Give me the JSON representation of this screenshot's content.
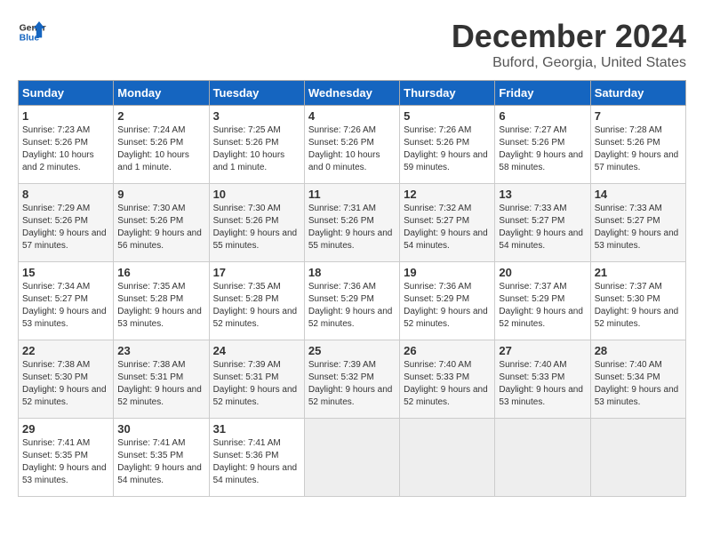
{
  "header": {
    "logo_general": "General",
    "logo_blue": "Blue",
    "month_title": "December 2024",
    "location": "Buford, Georgia, United States"
  },
  "calendar": {
    "days_of_week": [
      "Sunday",
      "Monday",
      "Tuesday",
      "Wednesday",
      "Thursday",
      "Friday",
      "Saturday"
    ],
    "weeks": [
      [
        null,
        null,
        null,
        null,
        null,
        null,
        null
      ]
    ]
  },
  "days": {
    "d1": {
      "num": "1",
      "sunrise": "Sunrise: 7:23 AM",
      "sunset": "Sunset: 5:26 PM",
      "daylight": "Daylight: 10 hours and 2 minutes."
    },
    "d2": {
      "num": "2",
      "sunrise": "Sunrise: 7:24 AM",
      "sunset": "Sunset: 5:26 PM",
      "daylight": "Daylight: 10 hours and 1 minute."
    },
    "d3": {
      "num": "3",
      "sunrise": "Sunrise: 7:25 AM",
      "sunset": "Sunset: 5:26 PM",
      "daylight": "Daylight: 10 hours and 1 minute."
    },
    "d4": {
      "num": "4",
      "sunrise": "Sunrise: 7:26 AM",
      "sunset": "Sunset: 5:26 PM",
      "daylight": "Daylight: 10 hours and 0 minutes."
    },
    "d5": {
      "num": "5",
      "sunrise": "Sunrise: 7:26 AM",
      "sunset": "Sunset: 5:26 PM",
      "daylight": "Daylight: 9 hours and 59 minutes."
    },
    "d6": {
      "num": "6",
      "sunrise": "Sunrise: 7:27 AM",
      "sunset": "Sunset: 5:26 PM",
      "daylight": "Daylight: 9 hours and 58 minutes."
    },
    "d7": {
      "num": "7",
      "sunrise": "Sunrise: 7:28 AM",
      "sunset": "Sunset: 5:26 PM",
      "daylight": "Daylight: 9 hours and 57 minutes."
    },
    "d8": {
      "num": "8",
      "sunrise": "Sunrise: 7:29 AM",
      "sunset": "Sunset: 5:26 PM",
      "daylight": "Daylight: 9 hours and 57 minutes."
    },
    "d9": {
      "num": "9",
      "sunrise": "Sunrise: 7:30 AM",
      "sunset": "Sunset: 5:26 PM",
      "daylight": "Daylight: 9 hours and 56 minutes."
    },
    "d10": {
      "num": "10",
      "sunrise": "Sunrise: 7:30 AM",
      "sunset": "Sunset: 5:26 PM",
      "daylight": "Daylight: 9 hours and 55 minutes."
    },
    "d11": {
      "num": "11",
      "sunrise": "Sunrise: 7:31 AM",
      "sunset": "Sunset: 5:26 PM",
      "daylight": "Daylight: 9 hours and 55 minutes."
    },
    "d12": {
      "num": "12",
      "sunrise": "Sunrise: 7:32 AM",
      "sunset": "Sunset: 5:27 PM",
      "daylight": "Daylight: 9 hours and 54 minutes."
    },
    "d13": {
      "num": "13",
      "sunrise": "Sunrise: 7:33 AM",
      "sunset": "Sunset: 5:27 PM",
      "daylight": "Daylight: 9 hours and 54 minutes."
    },
    "d14": {
      "num": "14",
      "sunrise": "Sunrise: 7:33 AM",
      "sunset": "Sunset: 5:27 PM",
      "daylight": "Daylight: 9 hours and 53 minutes."
    },
    "d15": {
      "num": "15",
      "sunrise": "Sunrise: 7:34 AM",
      "sunset": "Sunset: 5:27 PM",
      "daylight": "Daylight: 9 hours and 53 minutes."
    },
    "d16": {
      "num": "16",
      "sunrise": "Sunrise: 7:35 AM",
      "sunset": "Sunset: 5:28 PM",
      "daylight": "Daylight: 9 hours and 53 minutes."
    },
    "d17": {
      "num": "17",
      "sunrise": "Sunrise: 7:35 AM",
      "sunset": "Sunset: 5:28 PM",
      "daylight": "Daylight: 9 hours and 52 minutes."
    },
    "d18": {
      "num": "18",
      "sunrise": "Sunrise: 7:36 AM",
      "sunset": "Sunset: 5:29 PM",
      "daylight": "Daylight: 9 hours and 52 minutes."
    },
    "d19": {
      "num": "19",
      "sunrise": "Sunrise: 7:36 AM",
      "sunset": "Sunset: 5:29 PM",
      "daylight": "Daylight: 9 hours and 52 minutes."
    },
    "d20": {
      "num": "20",
      "sunrise": "Sunrise: 7:37 AM",
      "sunset": "Sunset: 5:29 PM",
      "daylight": "Daylight: 9 hours and 52 minutes."
    },
    "d21": {
      "num": "21",
      "sunrise": "Sunrise: 7:37 AM",
      "sunset": "Sunset: 5:30 PM",
      "daylight": "Daylight: 9 hours and 52 minutes."
    },
    "d22": {
      "num": "22",
      "sunrise": "Sunrise: 7:38 AM",
      "sunset": "Sunset: 5:30 PM",
      "daylight": "Daylight: 9 hours and 52 minutes."
    },
    "d23": {
      "num": "23",
      "sunrise": "Sunrise: 7:38 AM",
      "sunset": "Sunset: 5:31 PM",
      "daylight": "Daylight: 9 hours and 52 minutes."
    },
    "d24": {
      "num": "24",
      "sunrise": "Sunrise: 7:39 AM",
      "sunset": "Sunset: 5:31 PM",
      "daylight": "Daylight: 9 hours and 52 minutes."
    },
    "d25": {
      "num": "25",
      "sunrise": "Sunrise: 7:39 AM",
      "sunset": "Sunset: 5:32 PM",
      "daylight": "Daylight: 9 hours and 52 minutes."
    },
    "d26": {
      "num": "26",
      "sunrise": "Sunrise: 7:40 AM",
      "sunset": "Sunset: 5:33 PM",
      "daylight": "Daylight: 9 hours and 52 minutes."
    },
    "d27": {
      "num": "27",
      "sunrise": "Sunrise: 7:40 AM",
      "sunset": "Sunset: 5:33 PM",
      "daylight": "Daylight: 9 hours and 53 minutes."
    },
    "d28": {
      "num": "28",
      "sunrise": "Sunrise: 7:40 AM",
      "sunset": "Sunset: 5:34 PM",
      "daylight": "Daylight: 9 hours and 53 minutes."
    },
    "d29": {
      "num": "29",
      "sunrise": "Sunrise: 7:41 AM",
      "sunset": "Sunset: 5:35 PM",
      "daylight": "Daylight: 9 hours and 53 minutes."
    },
    "d30": {
      "num": "30",
      "sunrise": "Sunrise: 7:41 AM",
      "sunset": "Sunset: 5:35 PM",
      "daylight": "Daylight: 9 hours and 54 minutes."
    },
    "d31": {
      "num": "31",
      "sunrise": "Sunrise: 7:41 AM",
      "sunset": "Sunset: 5:36 PM",
      "daylight": "Daylight: 9 hours and 54 minutes."
    }
  }
}
